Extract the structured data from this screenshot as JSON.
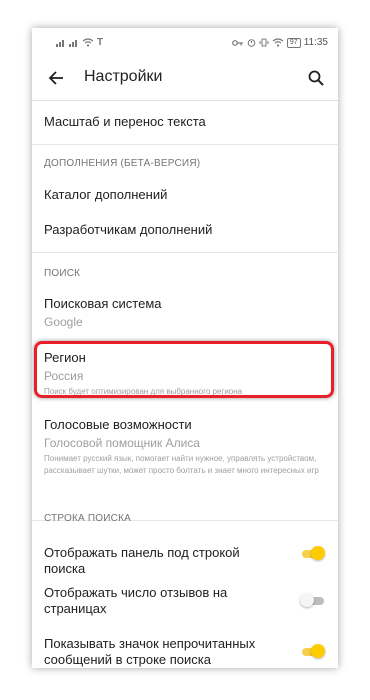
{
  "statusbar": {
    "left_icons": [
      "signal-icon",
      "signal-icon",
      "wifi-icon",
      "t-icon"
    ],
    "right_icons": [
      "key-icon",
      "alarm-icon",
      "vibrate-icon",
      "wifi-icon"
    ],
    "battery": "97",
    "time": "11:35"
  },
  "appbar": {
    "title": "Настройки"
  },
  "items": {
    "text_scale": "Масштаб и перенос текста",
    "addons_header": "ДОПОЛНЕНИЯ (БЕТА-ВЕРСИЯ)",
    "addons_catalog": "Каталог дополнений",
    "addons_dev": "Разработчикам дополнений",
    "search_header": "ПОИСК",
    "search_engine_title": "Поисковая система",
    "search_engine_value": "Google",
    "region_title": "Регион",
    "region_value": "Россия",
    "region_desc": "Поиск будет оптимизирован для выбранного региона",
    "voice_title": "Голосовые возможности",
    "voice_value": "Голосовой помощник Алиса",
    "voice_desc": "Понимает русский язык, помогает найти нужное, управлять устройством, рассказывает шутки, может просто болтать и знает много интересных игр",
    "searchbar_header": "СТРОКА ПОИСКА",
    "show_panel_label": "Отображать панель под строкой поиска",
    "show_reviews_label": "Отображать число отзывов на страницах",
    "show_unread_label": "Показывать значок непрочитанных сообщений в строке поиска"
  },
  "toggles": {
    "show_panel": true,
    "show_reviews": false,
    "show_unread": true
  },
  "colors": {
    "toggle_on": "#ffcc00",
    "highlight": "#e8202a"
  }
}
